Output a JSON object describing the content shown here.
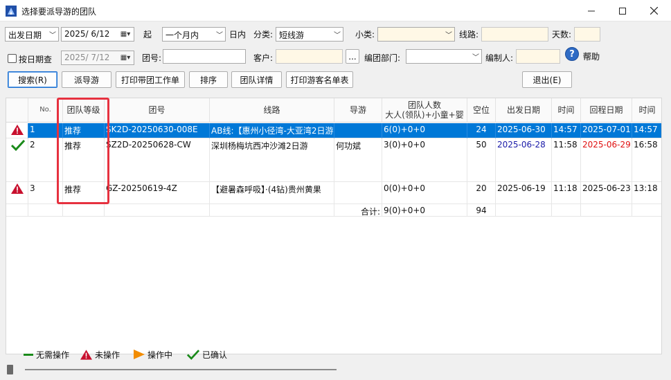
{
  "window": {
    "title": "选择要派导游的团队"
  },
  "filters": {
    "date_type": "出发日期",
    "start_date": "2025/ 6/12",
    "start_suffix": "起",
    "range": "一个月内",
    "range_suffix": "日内",
    "category_label": "分类:",
    "category": "短线游",
    "subcategory_label": "小类:",
    "subcategory": "",
    "route_label": "线路:",
    "route": "",
    "days_label": "天数:",
    "days": "",
    "by_date_label": "按日期查",
    "end_date": "2025/ 7/12",
    "group_no_label": "团号:",
    "group_no": "",
    "customer_label": "客户:",
    "customer": "",
    "customer_button": "...",
    "dept_label": "编团部门:",
    "dept": "",
    "creator_label": "编制人:",
    "creator": "",
    "help_label": "帮助",
    "help_icon": "?"
  },
  "toolbar": {
    "search": "搜索(R)",
    "assign": "派导游",
    "print_worksheet": "打印带团工作单",
    "sort": "排序",
    "team_detail": "团队详情",
    "print_guest_list": "打印游客名单表",
    "exit": "退出(E)"
  },
  "table": {
    "headers": {
      "no": "No.",
      "level": "团队等级",
      "group_no": "团号",
      "route": "线路",
      "guide": "导游",
      "people_line1": "团队人数",
      "people_line2": "大人(领队)+小童+婴",
      "vacancy": "空位",
      "depart_date": "出发日期",
      "depart_time": "时间",
      "return_date": "回程日期",
      "return_time": "时间"
    },
    "rows": [
      {
        "status_icon": "warning-icon",
        "no": "1",
        "level": "推荐",
        "group_no": "SK2D-20250630-008E",
        "route": "AB线:【惠州小径湾-大亚湾2日游",
        "guide": "",
        "people": "6(0)+0+0",
        "vacancy": "24",
        "depart_date": "2025-06-30",
        "depart_time": "14:57",
        "return_date": "2025-07-01",
        "return_time": "14:57"
      },
      {
        "status_icon": "check-icon",
        "no": "2",
        "level": "推荐",
        "group_no": "SZ2D-20250628-CW",
        "route": "深圳杨梅坑西冲沙滩2日游",
        "guide": "何功斌",
        "people": "3(0)+0+0",
        "vacancy": "50",
        "depart_date": "2025-06-28",
        "depart_time": "11:58",
        "return_date": "2025-06-29",
        "return_time": "16:58"
      },
      {
        "status_icon": "warning-icon",
        "no": "3",
        "level": "推荐",
        "group_no": "GZ-20250619-4Z",
        "route": "【避暑森呼吸】·(4钻)贵州黄果",
        "guide": "",
        "people": "0(0)+0+0",
        "vacancy": "20",
        "depart_date": "2025-06-19",
        "depart_time": "11:18",
        "return_date": "2025-06-23",
        "return_time": "13:18"
      }
    ],
    "total": {
      "label": "合计:",
      "people": "9(0)+0+0",
      "vacancy": "94"
    }
  },
  "legend": {
    "none": "无需操作",
    "not_done": "未操作",
    "in_progress": "操作中",
    "confirmed": "已确认"
  },
  "colors": {
    "selection": "#0078d7",
    "highlight": "#e6313f",
    "warning": "#c8102e",
    "check": "#1a8a1a",
    "in_progress": "#f28c00",
    "date_blue": "#1a1aa8",
    "date_red": "#e01010"
  }
}
